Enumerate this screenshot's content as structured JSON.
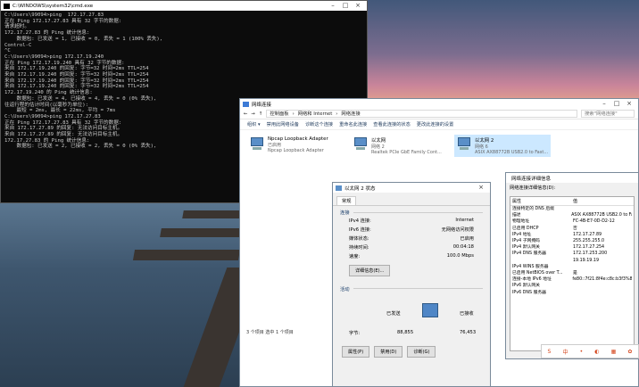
{
  "cmd": {
    "title": "C:\\WINDOWS\\system32\\cmd.exe",
    "lines": [
      "C:\\Users\\99094>ping  172.17.27.83",
      "",
      "正在 Ping 172.17.27.83 具有 32 字节的数据:",
      "请求超时。",
      "",
      "172.17.27.83 的 Ping 统计信息:",
      "    数据包: 已发送 = 1, 已接收 = 0, 丢失 = 1 (100% 丢失),",
      "Control-C",
      "^C",
      "C:\\Users\\99094>ping 172.17.19.240",
      "",
      "正在 Ping 172.17.19.240 具有 32 字节的数据:",
      "来自 172.17.19.240 的回复: 字节=32 时间=2ms TTL=254",
      "来自 172.17.19.240 的回复: 字节=32 时间=2ms TTL=254",
      "来自 172.17.19.240 的回复: 字节=32 时间=2ms TTL=254",
      "来自 172.17.19.240 的回复: 字节=32 时间=2ms TTL=254",
      "",
      "172.17.19.240 的 Ping 统计信息:",
      "    数据包: 已发送 = 4, 已接收 = 4, 丢失 = 0 (0% 丢失),",
      "往返行程的估计时间(以毫秒为单位):",
      "    最短 = 2ms, 最长 = 22ms, 平均 = 7ms",
      "",
      "C:\\Users\\99094>ping 172.17.27.83",
      "",
      "正在 Ping 172.17.27.83 具有 32 字节的数据:",
      "来自 172.17.27.89 的回复: 无法访问目标主机。",
      "来自 172.17.27.89 的回复: 无法访问目标主机。",
      "",
      "172.17.27.83 的 Ping 统计信息:",
      "    数据包: 已发送 = 2, 已接收 = 2, 丢失 = 0 (0% 丢失),"
    ]
  },
  "net": {
    "title": "网络连接",
    "breadcrumb": [
      "控制面板",
      "网络和 Internet",
      "网络连接"
    ],
    "search": "搜索\"网络连接\"",
    "toolbar": [
      "组织 ▾",
      "禁用此网络设备",
      "诊断这个连接",
      "重命名此连接",
      "查看此连接的状态",
      "更改此连接的设置"
    ],
    "adapters": [
      {
        "name": "Npcap Loopback Adapter",
        "state": "已启用",
        "dev": "Npcap Loopback Adapter"
      },
      {
        "name": "以太网",
        "state": "网络 2",
        "dev": "Realtek PCIe GbE Family Cont..."
      },
      {
        "name": "以太网 2",
        "state": "网络 6",
        "dev": "ASIX AX88772B USB2.0 to Fast..."
      }
    ],
    "status": "3 个项目    选中 1 个项目"
  },
  "dlg": {
    "title": "以太网 2 状态",
    "tab": "常规",
    "conn_h": "连接",
    "rows": [
      [
        "IPv4 连接:",
        "Internet"
      ],
      [
        "IPv6 连接:",
        "无网络访问权限"
      ],
      [
        "媒体状态:",
        "已启用"
      ],
      [
        "持续时间:",
        "00:04:18"
      ],
      [
        "速度:",
        "100.0 Mbps"
      ]
    ],
    "details_btn": "详细信息(E)...",
    "act_h": "活动",
    "sent": "已发送",
    "recv": "已接收",
    "bytes_l": "字节:",
    "bytes_s": "88,855",
    "bytes_r": "76,453",
    "props": "属性(P)",
    "disable": "禁用(D)",
    "diag": "诊断(G)"
  },
  "det": {
    "title": "网络连接详细信息",
    "sub": "网络连接详细信息(D):",
    "h1": "属性",
    "h2": "值",
    "rows": [
      [
        "连接特定的 DNS 后缀",
        ""
      ],
      [
        "描述",
        "ASIX AX88772B USB2.0 to Fa"
      ],
      [
        "物理地址",
        "FC-4B-E7-0D-D2-12"
      ],
      [
        "已启用 DHCP",
        "否"
      ],
      [
        "IPv4 地址",
        "172.17.27.89"
      ],
      [
        "IPv4 子网掩码",
        "255.255.255.0"
      ],
      [
        "IPv4 默认网关",
        "172.17.27.254"
      ],
      [
        "IPv4 DNS 服务器",
        "172.17.253.200"
      ],
      [
        "",
        "19.19.19.19"
      ],
      [
        "IPv4 WINS 服务器",
        ""
      ],
      [
        "已启用 NetBIOS over T...",
        "是"
      ],
      [
        "连接-本地 IPv6 地址",
        "fe80::7f21:8f4e:c8c:b3f3%8"
      ],
      [
        "IPv6 默认网关",
        ""
      ],
      [
        "IPv6 DNS 服务器",
        ""
      ]
    ]
  }
}
